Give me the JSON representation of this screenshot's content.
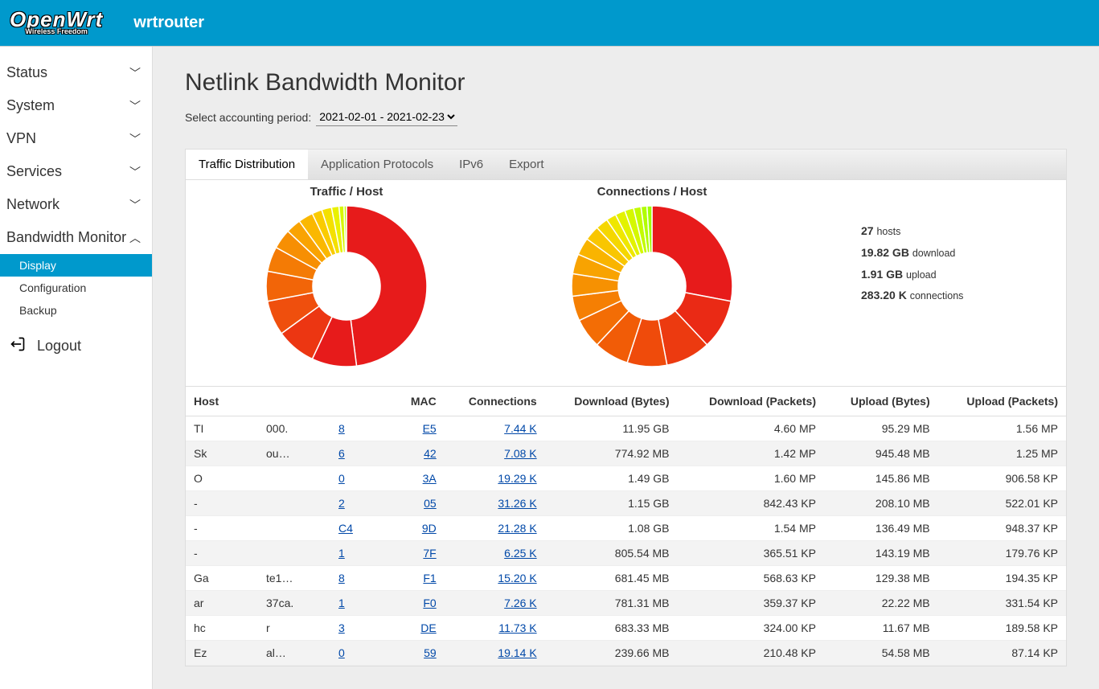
{
  "header": {
    "logo_main": "OpenWrt",
    "logo_sub": "Wireless Freedom",
    "hostname": "wrtrouter"
  },
  "sidebar": {
    "items": [
      {
        "label": "Status",
        "expandable": true
      },
      {
        "label": "System",
        "expandable": true
      },
      {
        "label": "VPN",
        "expandable": true
      },
      {
        "label": "Services",
        "expandable": true
      },
      {
        "label": "Network",
        "expandable": true
      },
      {
        "label": "Bandwidth Monitor",
        "expandable": true,
        "expanded": true,
        "children": [
          {
            "label": "Display",
            "active": true
          },
          {
            "label": "Configuration"
          },
          {
            "label": "Backup"
          }
        ]
      }
    ],
    "logout": "Logout"
  },
  "page": {
    "title": "Netlink Bandwidth Monitor",
    "period_label": "Select accounting period:",
    "period_value": "2021-02-01 - 2021-02-23"
  },
  "tabs": [
    "Traffic Distribution",
    "Application Protocols",
    "IPv6",
    "Export"
  ],
  "chart_titles": {
    "traffic": "Traffic / Host",
    "conns": "Connections / Host"
  },
  "summary": {
    "hosts_n": "27",
    "hosts_lbl": "hosts",
    "dl_v": "19.82 GB",
    "dl_lbl": "download",
    "ul_v": "1.91 GB",
    "ul_lbl": "upload",
    "conn_v": "283.20 K",
    "conn_lbl": "connections"
  },
  "table": {
    "headers": {
      "host": "Host",
      "mac": "MAC",
      "conn": "Connections",
      "db": "Download (Bytes)",
      "dp": "Download (Packets)",
      "ub": "Upload (Bytes)",
      "up": "Upload (Packets)"
    },
    "rows": [
      {
        "ha": "TI",
        "hb": "000.",
        "ip": "8",
        "mac": "E5",
        "conn": "7.44 K",
        "db": "11.95 GB",
        "dp": "4.60 MP",
        "ub": "95.29 MB",
        "up": "1.56 MP"
      },
      {
        "ha": "Sk",
        "hb": "ou…",
        "ip": "6",
        "mac": "42",
        "conn": "7.08 K",
        "db": "774.92 MB",
        "dp": "1.42 MP",
        "ub": "945.48 MB",
        "up": "1.25 MP"
      },
      {
        "ha": "O",
        "hb": "",
        "ip": "0",
        "mac": "3A",
        "conn": "19.29 K",
        "db": "1.49 GB",
        "dp": "1.60 MP",
        "ub": "145.86 MB",
        "up": "906.58 KP"
      },
      {
        "ha": "-",
        "hb": "",
        "ip": "2",
        "mac": "05",
        "conn": "31.26 K",
        "db": "1.15 GB",
        "dp": "842.43 KP",
        "ub": "208.10 MB",
        "up": "522.01 KP"
      },
      {
        "ha": "-",
        "hb": "",
        "ip": "C4",
        "mac": "9D",
        "conn": "21.28 K",
        "db": "1.08 GB",
        "dp": "1.54 MP",
        "ub": "136.49 MB",
        "up": "948.37 KP"
      },
      {
        "ha": "-",
        "hb": "",
        "ip": "1",
        "mac": "7F",
        "conn": "6.25 K",
        "db": "805.54 MB",
        "dp": "365.51 KP",
        "ub": "143.19 MB",
        "up": "179.76 KP"
      },
      {
        "ha": "Ga",
        "hb": "te1…",
        "ip": "8",
        "mac": "F1",
        "conn": "15.20 K",
        "db": "681.45 MB",
        "dp": "568.63 KP",
        "ub": "129.38 MB",
        "up": "194.35 KP"
      },
      {
        "ha": "ar",
        "hb": "37ca.",
        "ip": "1",
        "mac": "F0",
        "conn": "7.26 K",
        "db": "781.31 MB",
        "dp": "359.37 KP",
        "ub": "22.22 MB",
        "up": "331.54 KP"
      },
      {
        "ha": "hc",
        "hb": "r",
        "ip": "3",
        "mac": "DE",
        "conn": "11.73 K",
        "db": "683.33 MB",
        "dp": "324.00 KP",
        "ub": "11.67 MB",
        "up": "189.58 KP"
      },
      {
        "ha": "Ez",
        "hb": "al…",
        "ip": "0",
        "mac": "59",
        "conn": "19.14 K",
        "db": "239.66 MB",
        "dp": "210.48 KP",
        "ub": "54.58 MB",
        "up": "87.14 KP"
      }
    ]
  },
  "chart_data": [
    {
      "type": "pie",
      "title": "Traffic / Host",
      "slice_pct": [
        48,
        9,
        8,
        7,
        6,
        5,
        4,
        3,
        3,
        2,
        2,
        1.5,
        1,
        0.5
      ],
      "colors": [
        "#e71b1b",
        "#e71b1b",
        "#ec3612",
        "#ef4f0d",
        "#f26508",
        "#f47b05",
        "#f78f03",
        "#f9a302",
        "#fab801",
        "#facb00",
        "#f4e000",
        "#e9f100",
        "#d7f700",
        "#c4fb00"
      ]
    },
    {
      "type": "pie",
      "title": "Connections / Host",
      "slice_pct": [
        28,
        10,
        9,
        8,
        7,
        6,
        5,
        4.5,
        4,
        3.5,
        3,
        2.5,
        2,
        2,
        1.8,
        1.5,
        1.2,
        1
      ],
      "colors": [
        "#e71b1b",
        "#ea2a15",
        "#ec3a10",
        "#ef4b0b",
        "#f15c07",
        "#f36d05",
        "#f57f03",
        "#f69102",
        "#f8a301",
        "#f9b400",
        "#f9c600",
        "#f5d700",
        "#efe700",
        "#e3f200",
        "#d5f800",
        "#c3fb00",
        "#b1fd00",
        "#9eff00"
      ]
    }
  ],
  "icons": {
    "chevron": "⌄"
  }
}
